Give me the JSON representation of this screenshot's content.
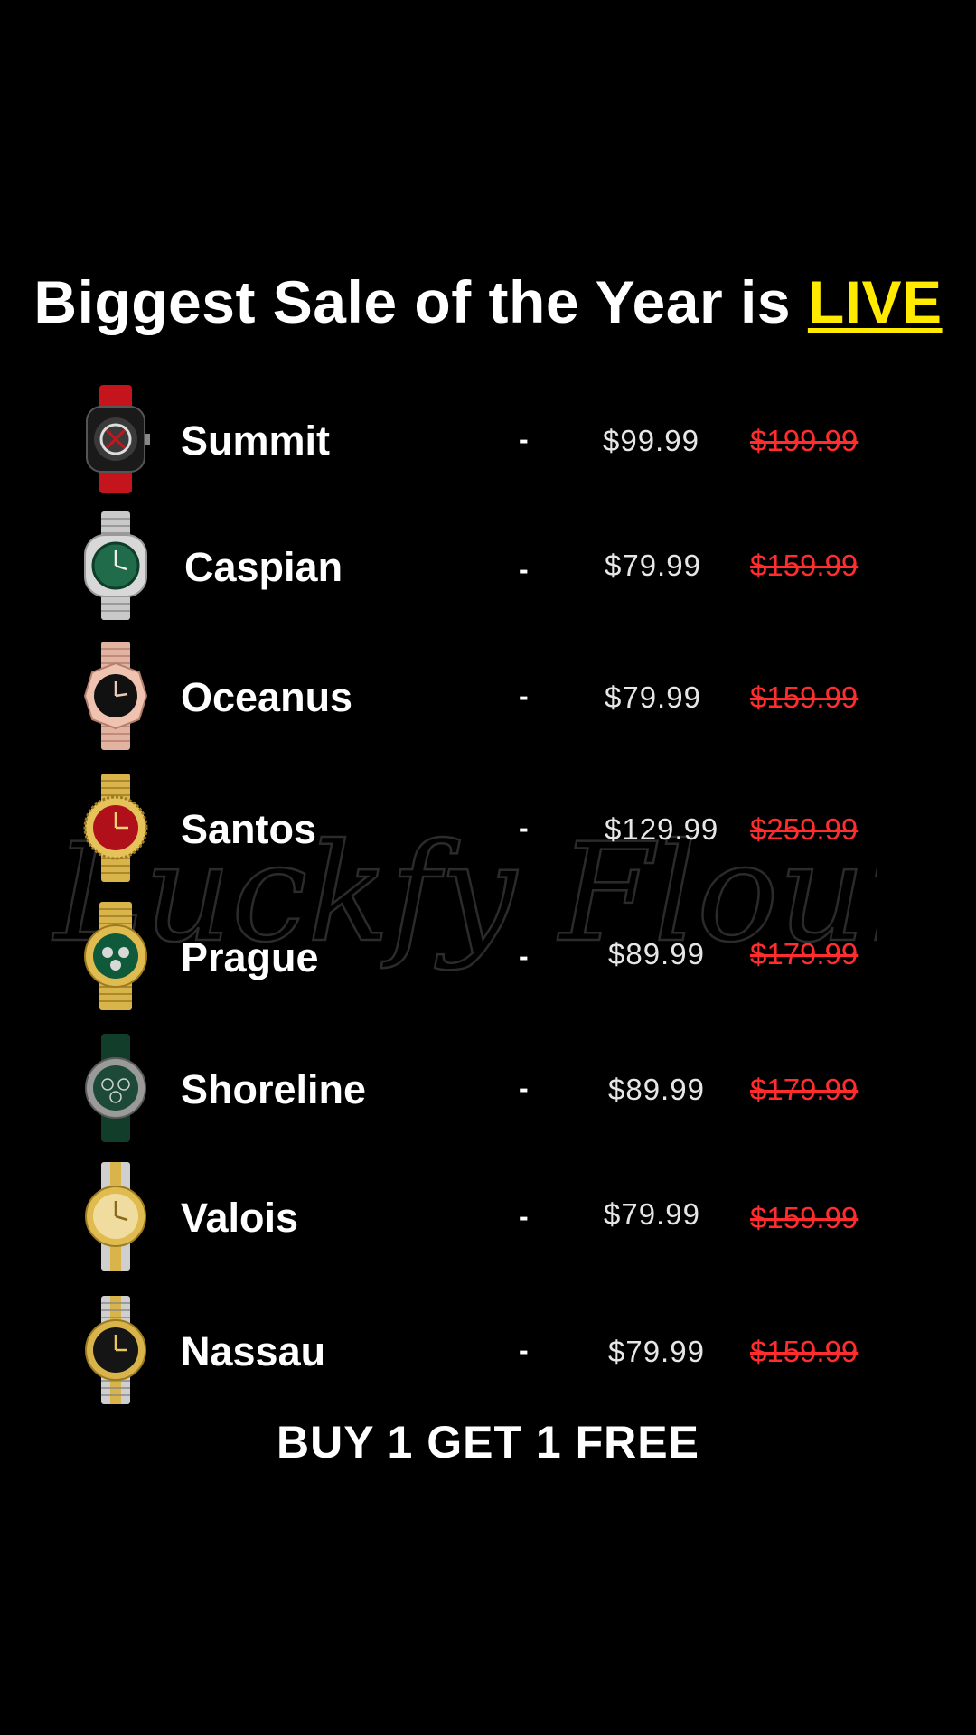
{
  "headline": {
    "prefix": "Biggest Sale of the Year is ",
    "accent": "LIVE",
    "accent_color": "#ffea00"
  },
  "watermark": {
    "brand": "Luckfy Flours"
  },
  "products": [
    {
      "name": "Summit",
      "separator": "-",
      "sale_price": "$99.99",
      "original_price": "$199.99",
      "icon": "watch-red-skeleton-icon"
    },
    {
      "name": "Caspian",
      "separator": "-",
      "sale_price": "$79.99",
      "original_price": "$159.99",
      "icon": "watch-silver-green-icon"
    },
    {
      "name": "Oceanus",
      "separator": "-",
      "sale_price": "$79.99",
      "original_price": "$159.99",
      "icon": "watch-rosegold-black-icon"
    },
    {
      "name": "Santos",
      "separator": "-",
      "sale_price": "$129.99",
      "original_price": "$259.99",
      "icon": "watch-gold-red-icon"
    },
    {
      "name": "Prague",
      "separator": "-",
      "sale_price": "$89.99",
      "original_price": "$179.99",
      "icon": "watch-gold-green-chrono-icon"
    },
    {
      "name": "Shoreline",
      "separator": "-",
      "sale_price": "$89.99",
      "original_price": "$179.99",
      "icon": "watch-green-leather-icon"
    },
    {
      "name": "Valois",
      "separator": "-",
      "sale_price": "$79.99",
      "original_price": "$159.99",
      "icon": "watch-twotone-champagne-icon"
    },
    {
      "name": "Nassau",
      "separator": "-",
      "sale_price": "$79.99",
      "original_price": "$159.99",
      "icon": "watch-twotone-black-icon"
    }
  ],
  "promo": "BUY 1 GET 1 FREE",
  "colors": {
    "background": "#000000",
    "text": "#ffffff",
    "sale_price": "#e6e6e6",
    "original_price": "#ff2d2d"
  }
}
